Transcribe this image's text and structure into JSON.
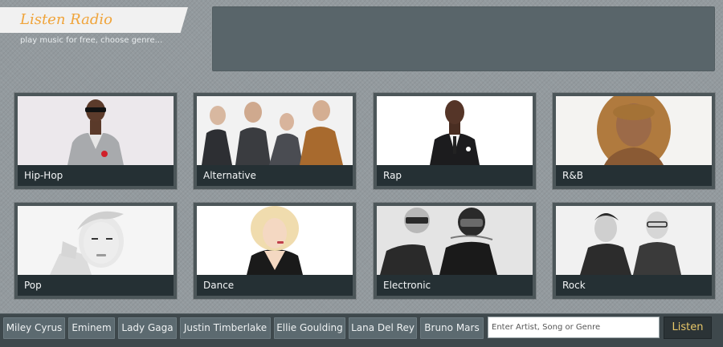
{
  "header": {
    "title": "Listen Radio",
    "tagline": "play music for free, choose genre..."
  },
  "genres": [
    {
      "label": "Hip-Hop"
    },
    {
      "label": "Alternative"
    },
    {
      "label": "Rap"
    },
    {
      "label": "R&B"
    },
    {
      "label": "Pop"
    },
    {
      "label": "Dance"
    },
    {
      "label": "Electronic"
    },
    {
      "label": "Rock"
    }
  ],
  "quick_artists": [
    {
      "label": "Miley Cyrus"
    },
    {
      "label": "Eminem"
    },
    {
      "label": "Lady Gaga"
    },
    {
      "label": "Justin Timberlake"
    },
    {
      "label": "Ellie Goulding"
    },
    {
      "label": "Lana Del Rey"
    },
    {
      "label": "Bruno Mars"
    }
  ],
  "search": {
    "placeholder": "Enter Artist, Song or Genre",
    "value": ""
  },
  "listen_label": "Listen",
  "colors": {
    "accent": "#f0a43a",
    "listen_text": "#e9c869",
    "caption_bg": "#253034",
    "background": "#939a9e"
  }
}
